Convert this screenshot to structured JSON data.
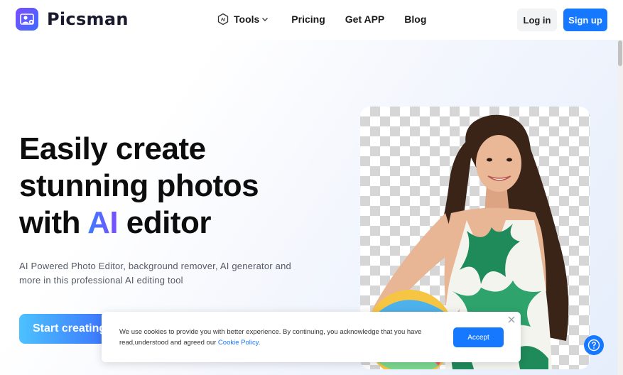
{
  "header": {
    "brand_name": "Picsman",
    "nav": {
      "tools": "Tools",
      "pricing": "Pricing",
      "get_app": "Get APP",
      "blog": "Blog"
    },
    "login_label": "Log in",
    "signup_label": "Sign up",
    "tools_badge": "AI"
  },
  "hero": {
    "headline_line1": "Easily create",
    "headline_line2": "stunning photos",
    "headline_line3_pre": "with ",
    "headline_line3_accent": "AI",
    "headline_line3_post": " editor",
    "subtext": "AI Powered Photo Editor, background remover, AI generator and more in this professional AI editing tool",
    "cta_label": "Start creating"
  },
  "cookie_banner": {
    "text": "We use cookies to provide you with better experience. By continuing, you acknowledge that you have read,understood and agreed our ",
    "link_text": "Cookie Policy",
    "text_end": ".",
    "accept_label": "Accept"
  },
  "icons": {
    "logo": "picsman-logo-icon",
    "tools_badge": "ai-badge-icon",
    "tools_chevron": "chevron-down-icon",
    "close": "close-icon",
    "help": "help-icon"
  },
  "colors": {
    "primary": "#1677ff",
    "accent_start": "#3b7cff",
    "accent_end": "#7b4dff"
  }
}
